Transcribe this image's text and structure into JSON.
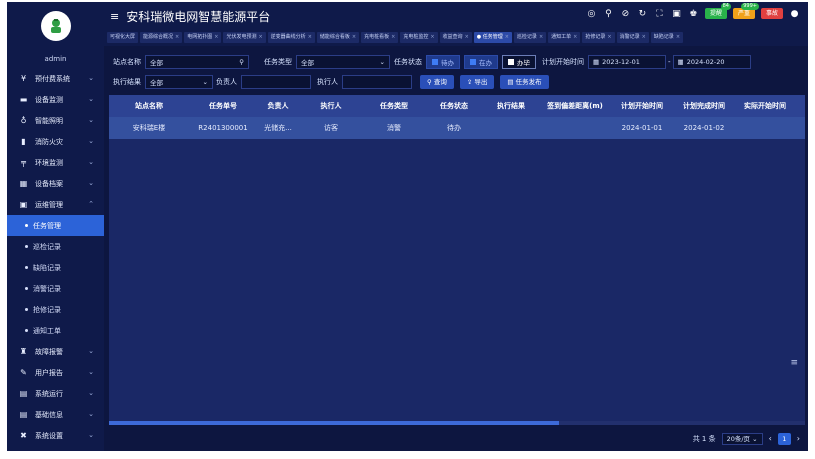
{
  "app": {
    "title": "安科瑞微电网智慧能源平台",
    "user": "admin"
  },
  "header": {
    "badges": [
      {
        "label": "提醒",
        "count": "84",
        "color": "#29b34a"
      },
      {
        "label": "严重",
        "count": "999+",
        "color": "#f0a11a"
      },
      {
        "label": "事故",
        "count": "",
        "color": "#e04040"
      }
    ]
  },
  "tabs": [
    {
      "label": "可视化大屏",
      "close": false,
      "active": false
    },
    {
      "label": "能源综合概况",
      "close": true,
      "active": false
    },
    {
      "label": "电网拓扑图",
      "close": true,
      "active": false
    },
    {
      "label": "光伏发电预测",
      "close": true,
      "active": false
    },
    {
      "label": "逆变器曲线分析",
      "close": true,
      "active": false
    },
    {
      "label": "储能综合看板",
      "close": true,
      "active": false
    },
    {
      "label": "充电桩看板",
      "close": true,
      "active": false
    },
    {
      "label": "充电桩监控",
      "close": true,
      "active": false
    },
    {
      "label": "收益查询",
      "close": true,
      "active": false
    },
    {
      "label": "● 任务管理",
      "close": true,
      "active": true
    },
    {
      "label": "巡检记录",
      "close": true,
      "active": false
    },
    {
      "label": "通知工单",
      "close": true,
      "active": false
    },
    {
      "label": "抢修记录",
      "close": true,
      "active": false
    },
    {
      "label": "消警记录",
      "close": true,
      "active": false
    },
    {
      "label": "缺陷记录",
      "close": true,
      "active": false
    }
  ],
  "sidebar": {
    "items": [
      {
        "label": "预付费系统",
        "icon": "yuan-icon",
        "glyph": "¥"
      },
      {
        "label": "设备监测",
        "icon": "monitor-icon",
        "glyph": "▬"
      },
      {
        "label": "智能照明",
        "icon": "bulb-icon",
        "glyph": "♁"
      },
      {
        "label": "消防火灾",
        "icon": "extinguisher-icon",
        "glyph": "▮"
      },
      {
        "label": "环境监测",
        "icon": "environment-icon",
        "glyph": "╤"
      },
      {
        "label": "设备档案",
        "icon": "archive-icon",
        "glyph": "▦"
      },
      {
        "label": "运维管理",
        "icon": "maintenance-icon",
        "glyph": "▣"
      }
    ],
    "sub_items": [
      {
        "label": "任务管理",
        "active": true
      },
      {
        "label": "巡检记录",
        "active": false
      },
      {
        "label": "缺陷记录",
        "active": false
      },
      {
        "label": "消警记录",
        "active": false
      },
      {
        "label": "抢修记录",
        "active": false
      },
      {
        "label": "通知工单",
        "active": false
      }
    ],
    "items_after": [
      {
        "label": "故障报警",
        "icon": "alarm-icon",
        "glyph": "♜"
      },
      {
        "label": "用户报告",
        "icon": "report-icon",
        "glyph": "✎"
      },
      {
        "label": "系统运行",
        "icon": "system-run-icon",
        "glyph": "▤"
      },
      {
        "label": "基础信息",
        "icon": "info-icon",
        "glyph": "▤"
      },
      {
        "label": "系统设置",
        "icon": "settings-icon",
        "glyph": "✖"
      }
    ]
  },
  "filters": {
    "station_label": "站点名称",
    "station_value": "全部",
    "task_type_label": "任务类型",
    "task_type_value": "全部",
    "task_status_label": "任务状态",
    "status_pending": "待办",
    "status_in_progress": "在办",
    "status_done": "办毕",
    "plan_start_label": "计划开始时间",
    "date_from": "2023-12-01",
    "date_sep": "-",
    "date_to": "2024-02-20",
    "result_label": "执行结果",
    "result_value": "全部",
    "owner_label": "负责人",
    "owner_value": "",
    "executor_label": "执行人",
    "executor_value": "",
    "query_button": "查询",
    "export_button": "导出",
    "publish_button": "任务发布"
  },
  "table": {
    "columns": [
      "站点名称",
      "任务单号",
      "负责人",
      "执行人",
      "任务类型",
      "任务状态",
      "执行结果",
      "签到偏差距离(m)",
      "计划开始时间",
      "计划完成时间",
      "实际开始时间"
    ],
    "rows": [
      [
        "安科瑞E楼",
        "R2401300001",
        "光储充...",
        "访客",
        "消警",
        "待办",
        "",
        "",
        "2024-01-01",
        "2024-01-02",
        ""
      ]
    ]
  },
  "pagination": {
    "total": "共 1 条",
    "page_size": "20条/页",
    "current_page": "1"
  }
}
